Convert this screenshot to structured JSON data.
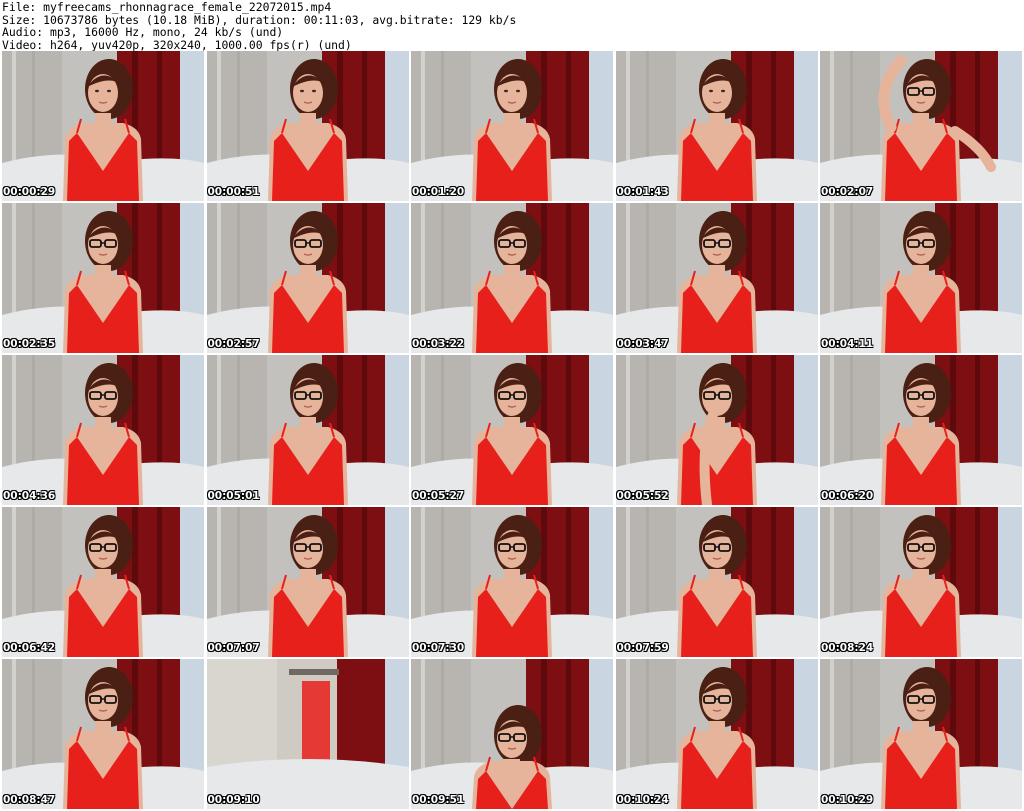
{
  "header": {
    "file_line": "File: myfreecams_rhonnagrace_female_22072015.mp4",
    "size_line": "Size: 10673786 bytes (10.18 MiB), duration: 00:11:03, avg.bitrate: 129 kb/s",
    "audio_line": "Audio: mp3, 16000 Hz, mono, 24 kb/s (und)",
    "video_line": "Video: h264, yuv420p, 320x240, 1000.00 fps(r) (und)"
  },
  "colors": {
    "dress_red": "#e8201c",
    "curtain_red": "#7d0f12",
    "wall_gray": "#c3c1bd",
    "sheet_white": "#e6e8ea",
    "skin": "#e5b49a",
    "hair": "#4a1f14",
    "timestamp_text": "#ffffff"
  },
  "thumbnails": [
    {
      "timestamp": "00:00:29",
      "glasses": false,
      "scene": "person"
    },
    {
      "timestamp": "00:00:51",
      "glasses": false,
      "scene": "person"
    },
    {
      "timestamp": "00:01:20",
      "glasses": false,
      "scene": "person"
    },
    {
      "timestamp": "00:01:43",
      "glasses": false,
      "scene": "person"
    },
    {
      "timestamp": "00:02:07",
      "glasses": true,
      "scene": "arm-raised"
    },
    {
      "timestamp": "00:02:35",
      "glasses": true,
      "scene": "person"
    },
    {
      "timestamp": "00:02:57",
      "glasses": true,
      "scene": "person"
    },
    {
      "timestamp": "00:03:22",
      "glasses": true,
      "scene": "person"
    },
    {
      "timestamp": "00:03:47",
      "glasses": true,
      "scene": "person"
    },
    {
      "timestamp": "00:04:11",
      "glasses": true,
      "scene": "person"
    },
    {
      "timestamp": "00:04:36",
      "glasses": true,
      "scene": "person"
    },
    {
      "timestamp": "00:05:01",
      "glasses": true,
      "scene": "person"
    },
    {
      "timestamp": "00:05:27",
      "glasses": true,
      "scene": "person"
    },
    {
      "timestamp": "00:05:52",
      "glasses": true,
      "scene": "hand-to-mouth"
    },
    {
      "timestamp": "00:06:20",
      "glasses": true,
      "scene": "person"
    },
    {
      "timestamp": "00:06:42",
      "glasses": true,
      "scene": "person"
    },
    {
      "timestamp": "00:07:07",
      "glasses": true,
      "scene": "person"
    },
    {
      "timestamp": "00:07:30",
      "glasses": true,
      "scene": "person"
    },
    {
      "timestamp": "00:07:59",
      "glasses": true,
      "scene": "person"
    },
    {
      "timestamp": "00:08:24",
      "glasses": true,
      "scene": "person"
    },
    {
      "timestamp": "00:08:47",
      "glasses": true,
      "scene": "person"
    },
    {
      "timestamp": "00:09:10",
      "glasses": false,
      "scene": "empty-room"
    },
    {
      "timestamp": "00:09:51",
      "glasses": true,
      "scene": "leaning-down"
    },
    {
      "timestamp": "00:10:24",
      "glasses": true,
      "scene": "person"
    },
    {
      "timestamp": "00:10:29",
      "glasses": true,
      "scene": "person"
    }
  ]
}
